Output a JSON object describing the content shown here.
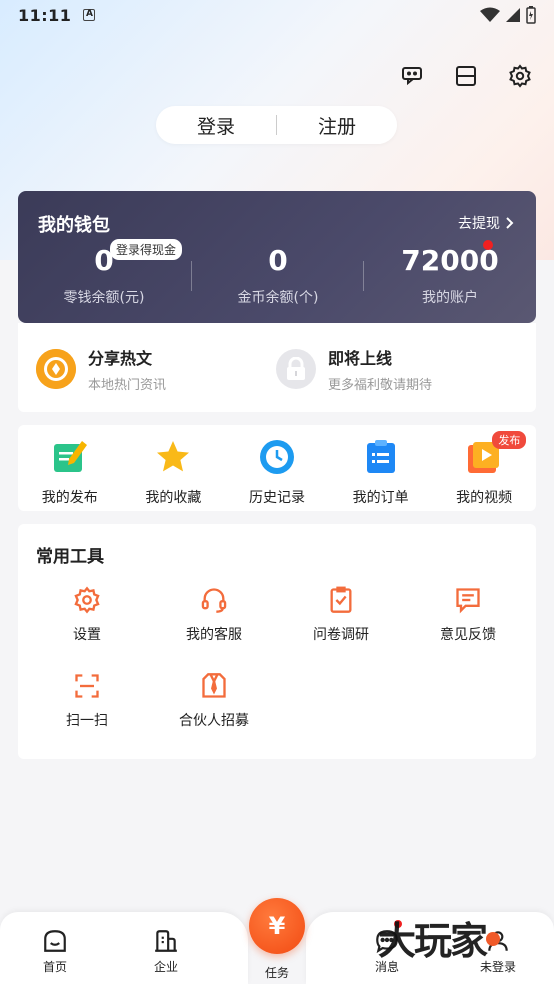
{
  "status_bar": {
    "time": "11:11",
    "indicator": "A"
  },
  "top_icons": [
    "headset-icon",
    "scan-icon",
    "gear-icon"
  ],
  "auth": {
    "login": "登录",
    "register": "注册"
  },
  "wallet": {
    "title": "我的钱包",
    "withdraw": "去提现",
    "badge": "登录得现金",
    "items": [
      {
        "value": "0",
        "label": "零钱余额(元)"
      },
      {
        "value": "0",
        "label": "金币余额(个)"
      },
      {
        "value": "72000",
        "label": "我的账户"
      }
    ]
  },
  "promo": [
    {
      "title": "分享热文",
      "subtitle": "本地热门资讯"
    },
    {
      "title": "即将上线",
      "subtitle": "更多福利敬请期待"
    }
  ],
  "quick": {
    "publish_tag": "发布",
    "items": [
      {
        "label": "我的发布",
        "icon": "edit-icon"
      },
      {
        "label": "我的收藏",
        "icon": "star-icon"
      },
      {
        "label": "历史记录",
        "icon": "clock-icon"
      },
      {
        "label": "我的订单",
        "icon": "order-icon"
      },
      {
        "label": "我的视频",
        "icon": "video-icon"
      }
    ]
  },
  "tools": {
    "title": "常用工具",
    "items": [
      {
        "label": "设置",
        "icon": "gear-icon"
      },
      {
        "label": "我的客服",
        "icon": "headset-icon"
      },
      {
        "label": "问卷调研",
        "icon": "survey-icon"
      },
      {
        "label": "意见反馈",
        "icon": "feedback-icon"
      },
      {
        "label": "扫一扫",
        "icon": "scan-icon"
      },
      {
        "label": "合伙人招募",
        "icon": "partner-icon"
      }
    ]
  },
  "tabbar": {
    "tabs": [
      {
        "label": "首页",
        "icon": "home-icon"
      },
      {
        "label": "企业",
        "icon": "building-icon"
      },
      {
        "label": "任务",
        "icon": "yuan-icon"
      },
      {
        "label": "消息",
        "icon": "chat-icon"
      },
      {
        "label": "未登录",
        "icon": "user-icon"
      }
    ],
    "task_symbol": "¥"
  },
  "watermark": "大玩家",
  "colors": {
    "accent": "#f24a12",
    "wallet_bg": "#3b3b58",
    "icon_orange": "#f36c3c"
  }
}
